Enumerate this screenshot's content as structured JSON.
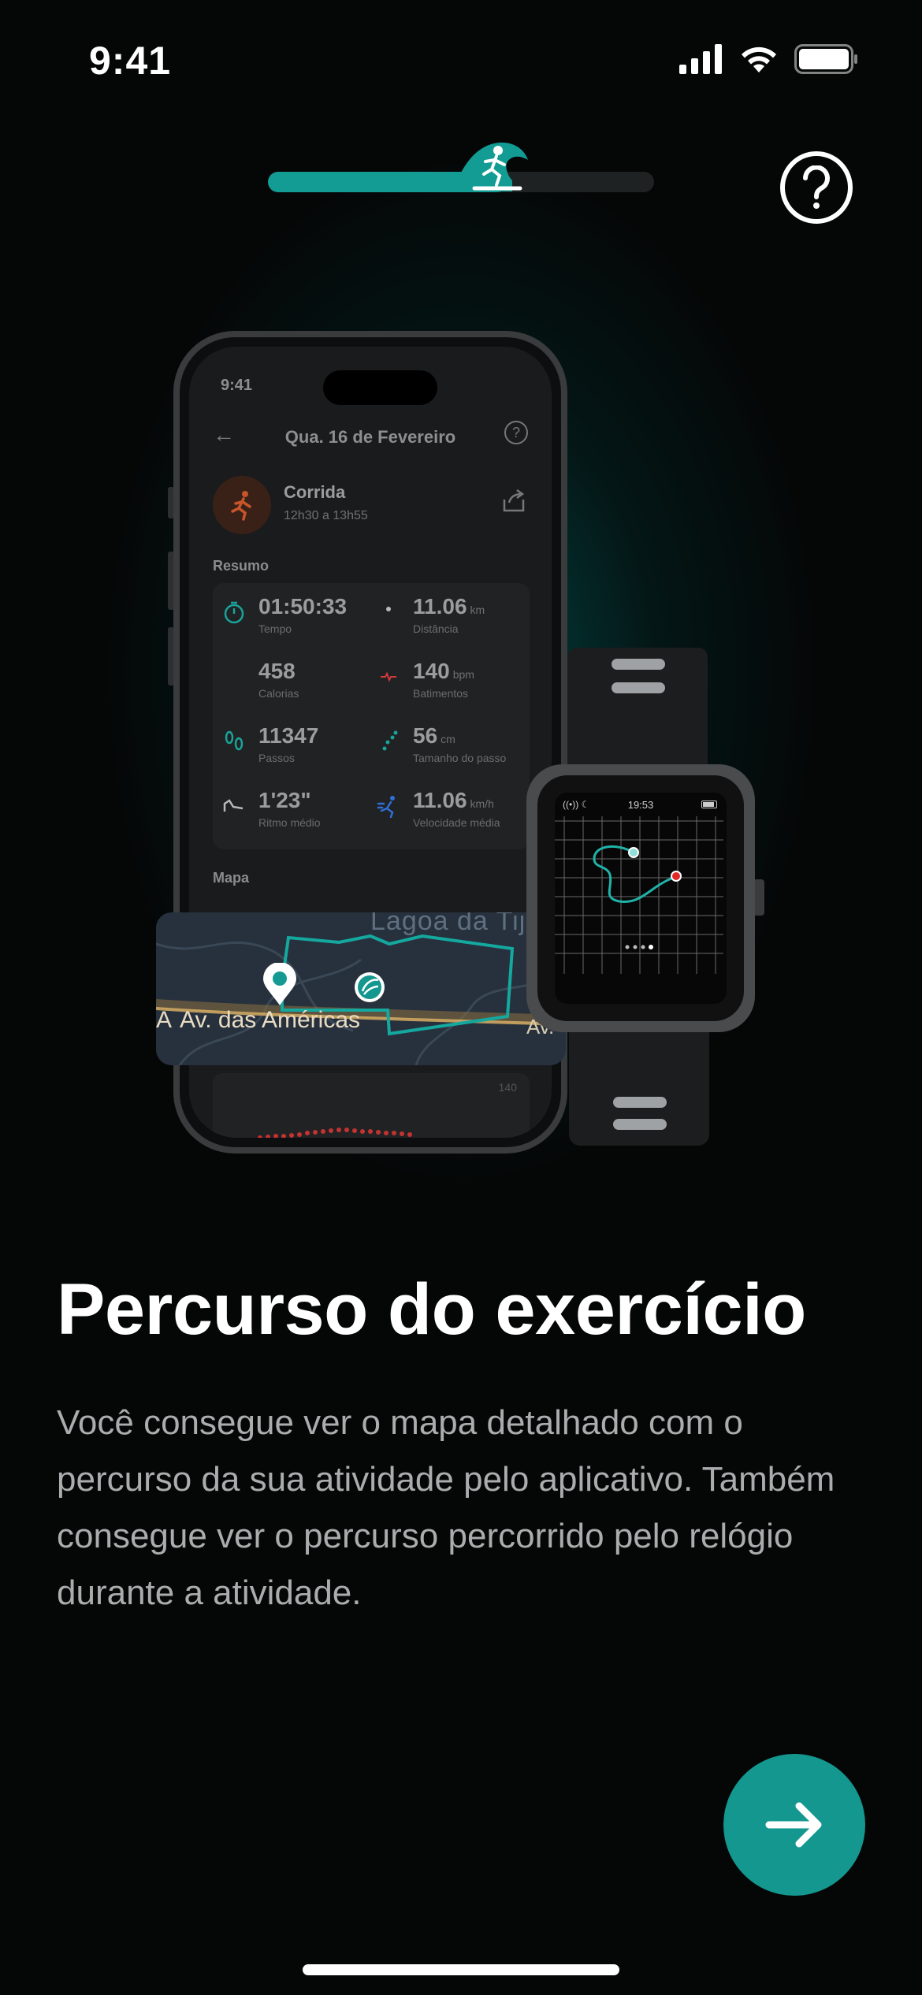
{
  "status_bar": {
    "time": "9:41",
    "icons": [
      "cellular-signal-icon",
      "wifi-icon",
      "battery-icon"
    ]
  },
  "header": {
    "progress_fraction": 0.62,
    "progress_marker_icon": "surfer-icon",
    "help_icon": "help-icon",
    "help_label": "?"
  },
  "phone_screen": {
    "time": "9:41",
    "date": "Qua. 16 de Fevereiro",
    "activity": {
      "name": "Corrida",
      "time_range": "12h30 a 13h55",
      "icon": "running-icon"
    },
    "summary_heading": "Resumo",
    "stats": [
      {
        "value": "01:50:33",
        "unit": "",
        "label": "Tempo",
        "icon": "stopwatch-icon",
        "color": "#1aa39a"
      },
      {
        "value": "11.06",
        "unit": "km",
        "label": "Distância",
        "icon": "location-pin-icon",
        "color": "#b9b9b9"
      },
      {
        "value": "458",
        "unit": "",
        "label": "Calorias",
        "icon": "flame-icon",
        "color": "#d35a2c"
      },
      {
        "value": "140",
        "unit": "bpm",
        "label": "Batimentos",
        "icon": "heart-rate-icon",
        "color": "#d23a3a"
      },
      {
        "value": "11347",
        "unit": "",
        "label": "Passos",
        "icon": "footprints-icon",
        "color": "#1aa39a"
      },
      {
        "value": "56",
        "unit": "cm",
        "label": "Tamanho do passo",
        "icon": "stride-icon",
        "color": "#1aa39a"
      },
      {
        "value": "1'23\"",
        "unit": "",
        "label": "Ritmo médio",
        "icon": "shoe-icon",
        "color": "#b9b9b9"
      },
      {
        "value": "11.06",
        "unit": "km/h",
        "label": "Velocidade média",
        "icon": "speed-runner-icon",
        "color": "#2f6fd6"
      }
    ],
    "map_heading": "Mapa",
    "chart_tick": "140"
  },
  "map_card": {
    "street_label": "Av. das Américas",
    "street_label_partial": "Av.",
    "lagoon_label": "Lagoa da Tiju",
    "route_start_icon": "map-pin-icon",
    "route_marker_icon": "brand-logo-icon",
    "start_label": "A"
  },
  "watch": {
    "time": "19:53",
    "status_icons": "((•)) ☾"
  },
  "content": {
    "title": "Percurso do exercício",
    "description": "Você consegue ver o mapa detalhado com o percurso da sua atividade pelo aplicativo. Também consegue ver o percurso percorrido pelo relógio durante a atividade."
  },
  "footer": {
    "next_icon": "arrow-right-icon"
  },
  "colors": {
    "accent": "#13978f",
    "background": "#050606"
  }
}
